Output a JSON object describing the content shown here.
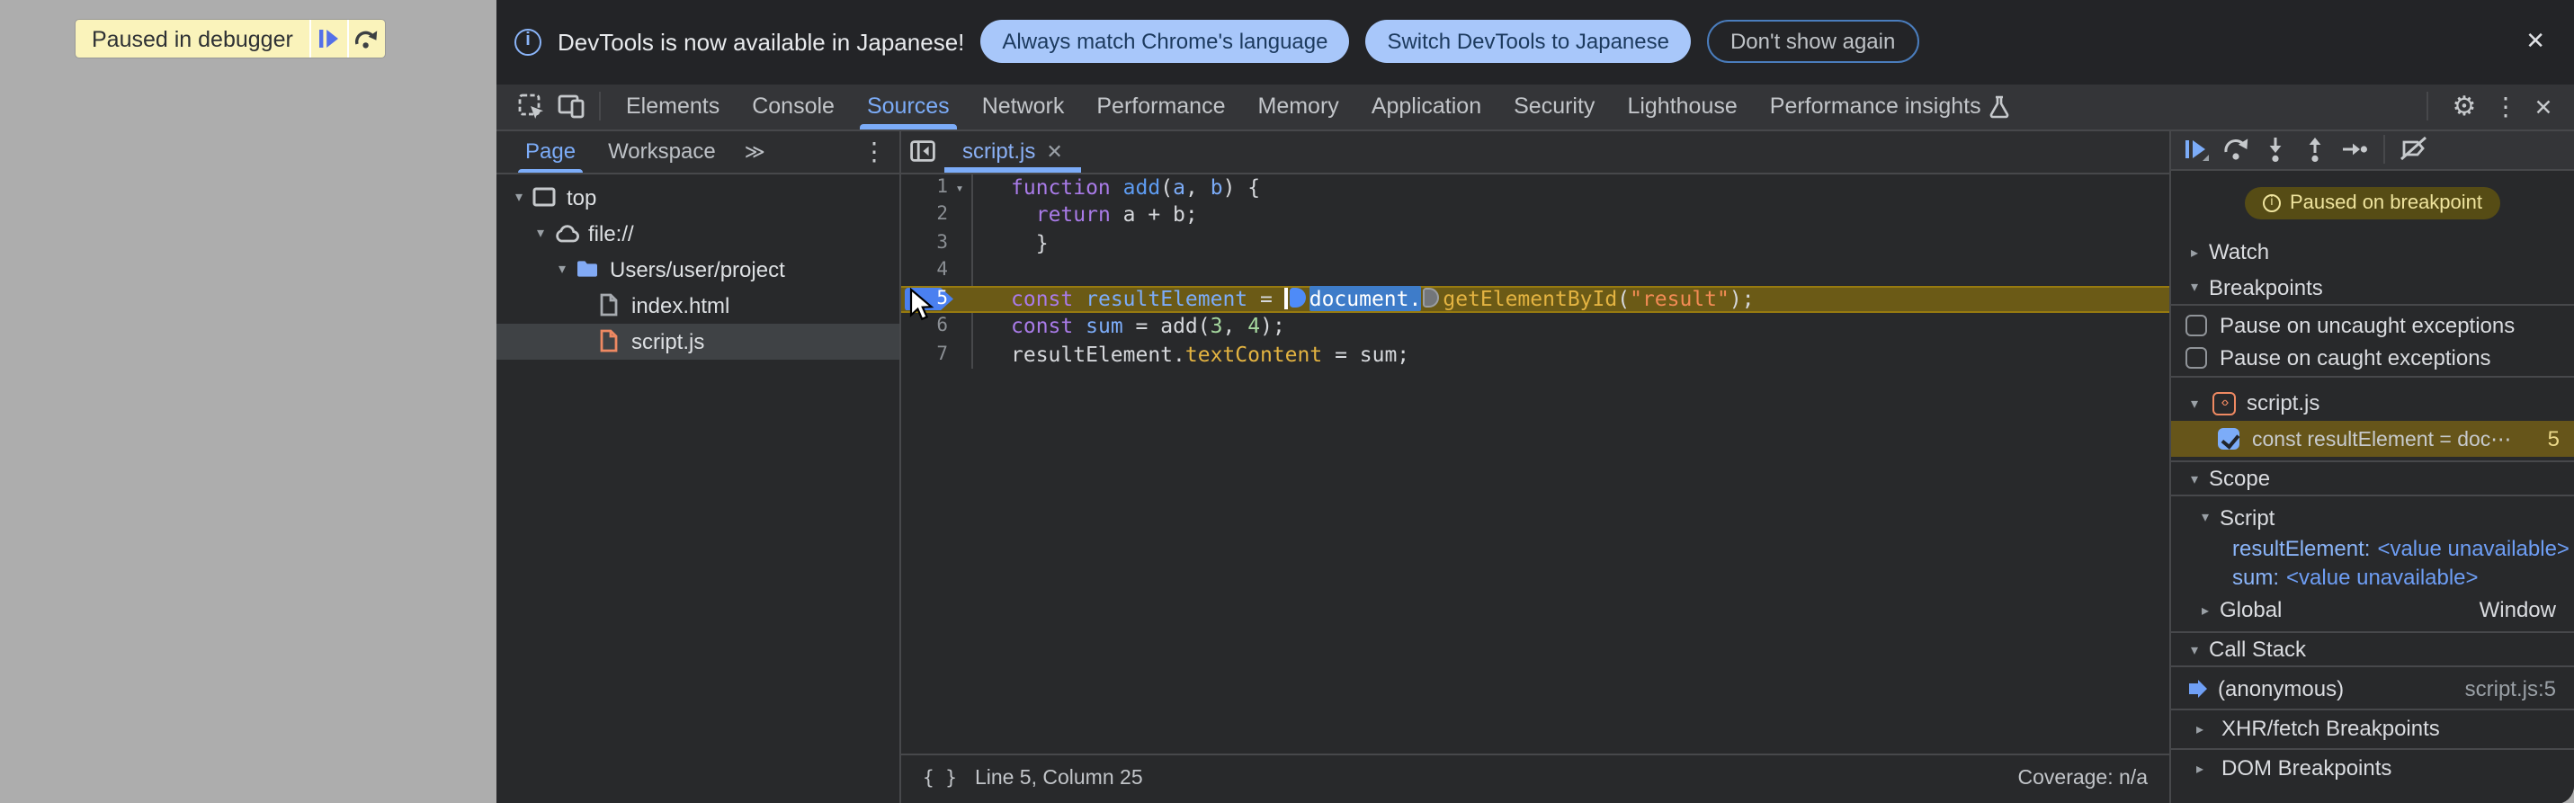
{
  "page": {
    "paused_banner": "Paused in debugger"
  },
  "infobar": {
    "message": "DevTools is now available in Japanese!",
    "action_primary": "Always match Chrome's language",
    "action_secondary": "Switch DevTools to Japanese",
    "action_dismiss": "Don't show again",
    "close": "✕"
  },
  "toolbar": {
    "tabs": [
      {
        "label": "Elements"
      },
      {
        "label": "Console"
      },
      {
        "label": "Sources",
        "selected": true
      },
      {
        "label": "Network"
      },
      {
        "label": "Performance"
      },
      {
        "label": "Memory"
      },
      {
        "label": "Application"
      },
      {
        "label": "Security"
      },
      {
        "label": "Lighthouse"
      },
      {
        "label": "Performance insights",
        "icon": "flask"
      }
    ],
    "right_icons": [
      "settings-gear",
      "kebab-menu",
      "close"
    ]
  },
  "nav": {
    "tabs": [
      {
        "label": "Page",
        "selected": true
      },
      {
        "label": "Workspace"
      }
    ],
    "more": "≫",
    "tree": [
      {
        "depth": 0,
        "arrow": "▾",
        "icon": "frame",
        "label": "top"
      },
      {
        "depth": 1,
        "arrow": "▾",
        "icon": "cloud",
        "label": "file://"
      },
      {
        "depth": 2,
        "arrow": "▾",
        "icon": "folder",
        "label": "Users/user/project"
      },
      {
        "depth": 3,
        "arrow": "",
        "icon": "file-html",
        "label": "index.html"
      },
      {
        "depth": 3,
        "arrow": "",
        "icon": "file-js",
        "label": "script.js",
        "selected": true
      }
    ]
  },
  "editor": {
    "tab": "script.js",
    "tab_close": "✕",
    "lines": [
      {
        "num": 1,
        "fold": "▾",
        "tokens": [
          [
            "kw",
            "function"
          ],
          [
            "pl",
            " "
          ],
          [
            "fn",
            "add"
          ],
          [
            "pl",
            "("
          ],
          [
            "va",
            "a"
          ],
          [
            "pl",
            ", "
          ],
          [
            "va",
            "b"
          ],
          [
            "pl",
            ") {"
          ]
        ]
      },
      {
        "num": 2,
        "tokens": [
          [
            "pl",
            "  "
          ],
          [
            "kw",
            "return"
          ],
          [
            "pl",
            " a + b;"
          ]
        ]
      },
      {
        "num": 3,
        "tokens": [
          [
            "pl",
            "  }"
          ]
        ]
      },
      {
        "num": 4,
        "tokens": []
      },
      {
        "num": 5,
        "exec": true,
        "tokens": [
          [
            "kw",
            "const"
          ],
          [
            "pl",
            " "
          ],
          [
            "va",
            "resultElement"
          ],
          [
            "pl",
            " = "
          ],
          [
            "caret",
            ""
          ],
          [
            "badge",
            "blue"
          ],
          [
            "sel",
            "document."
          ],
          [
            "badge",
            "gray"
          ],
          [
            "prop",
            "getElementById"
          ],
          [
            "pl",
            "("
          ],
          [
            "str",
            "\"result\""
          ],
          [
            "pl",
            ");"
          ]
        ]
      },
      {
        "num": 6,
        "tokens": [
          [
            "kw",
            "const"
          ],
          [
            "pl",
            " "
          ],
          [
            "va",
            "sum"
          ],
          [
            "pl",
            " = add("
          ],
          [
            "nu",
            "3"
          ],
          [
            "pl",
            ", "
          ],
          [
            "nu",
            "4"
          ],
          [
            "pl",
            ");"
          ]
        ]
      },
      {
        "num": 7,
        "tokens": [
          [
            "pl",
            "resultElement."
          ],
          [
            "prop",
            "textContent"
          ],
          [
            "pl",
            " = sum;"
          ]
        ]
      }
    ],
    "status": {
      "braces": "{ }",
      "position": "Line 5, Column 25",
      "coverage": "Coverage: n/a"
    }
  },
  "dbg": {
    "toolbar_icons": [
      "resume",
      "step-over",
      "step-into",
      "step-out",
      "step",
      "deactivate-breakpoints"
    ],
    "paused_pill": "Paused on breakpoint",
    "watch": "Watch",
    "breakpoints": "Breakpoints",
    "cb_uncaught": "Pause on uncaught exceptions",
    "cb_caught": "Pause on caught exceptions",
    "bp_file": "script.js",
    "bp_entry": "const resultElement = doc⋯",
    "bp_line": "5",
    "scope": "Scope",
    "scope_script": "Script",
    "var1": "resultElement",
    "var1_value": "<value unavailable>",
    "var2": "sum",
    "var2_value": "<value unavailable>",
    "global": "Global",
    "global_value": "Window",
    "call_stack": "Call Stack",
    "frame": "(anonymous)",
    "frame_loc": "script.js:5",
    "xhr": "XHR/fetch Breakpoints",
    "dom": "DOM Breakpoints"
  },
  "colors": {
    "accent": "#7cacf8",
    "exec_line_bg": "#6b5a16",
    "keyword": "#a97be8",
    "variable": "#7cacf8",
    "property": "#e3b341",
    "string": "#f28b54",
    "number": "#a5d79e",
    "selection": "#3e7cc9",
    "breakpoint_row_bg": "#66551a",
    "infobar_button_bg": "#a8c7fa",
    "paused_banner_bg": "#faf3bb"
  }
}
